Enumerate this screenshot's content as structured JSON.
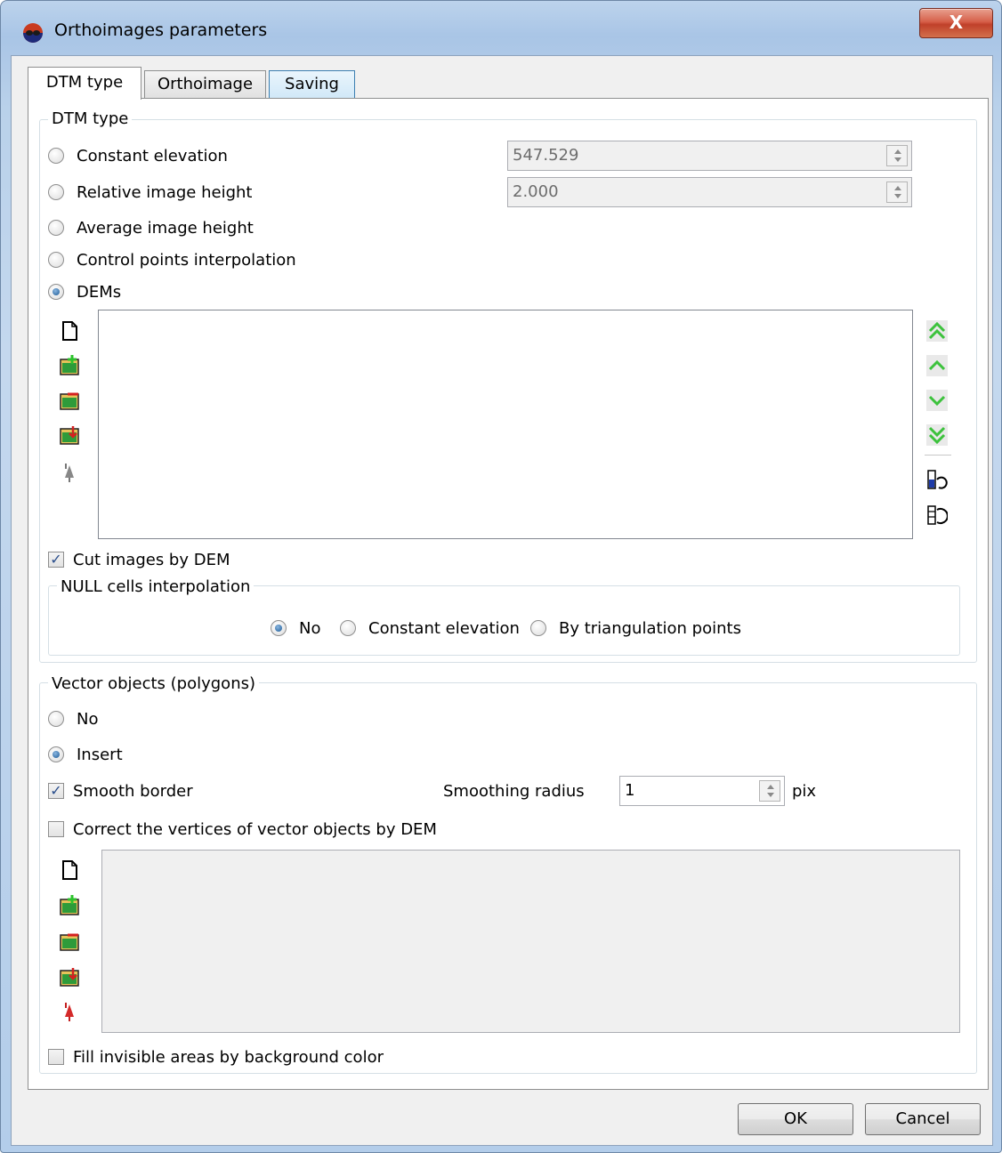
{
  "window": {
    "title": "Orthoimages parameters",
    "close_glyph": "X"
  },
  "tabs": [
    {
      "label": "DTM type",
      "active": true
    },
    {
      "label": "Orthoimage",
      "active": false
    },
    {
      "label": "Saving",
      "active": false
    }
  ],
  "dtm_group": {
    "title": "DTM type",
    "options": [
      {
        "label": "Constant elevation",
        "checked": false,
        "value": "547.529"
      },
      {
        "label": "Relative image height",
        "checked": false,
        "value": "2.000"
      },
      {
        "label": "Average image height",
        "checked": false
      },
      {
        "label": "Control points interpolation",
        "checked": false
      },
      {
        "label": "DEMs",
        "checked": true
      }
    ],
    "cut_images": {
      "label": "Cut images by DEM",
      "checked": true
    },
    "null_cells": {
      "title": "NULL cells interpolation",
      "options": [
        {
          "label": "No",
          "checked": true
        },
        {
          "label": "Constant elevation",
          "checked": false
        },
        {
          "label": "By triangulation points",
          "checked": false
        }
      ]
    }
  },
  "vector_group": {
    "title": "Vector objects (polygons)",
    "options": [
      {
        "label": "No",
        "checked": false
      },
      {
        "label": "Insert",
        "checked": true
      }
    ],
    "smooth_border": {
      "label": "Smooth border",
      "checked": true
    },
    "smoothing_radius": {
      "label": "Smoothing radius",
      "value": "1",
      "unit": "pix"
    },
    "correct_vertices": {
      "label": "Correct the vertices of vector objects by DEM",
      "checked": false
    },
    "fill_invisible": {
      "label": "Fill invisible areas by background color",
      "checked": false
    }
  },
  "footer": {
    "ok_label": "OK",
    "cancel_label": "Cancel"
  },
  "colors": {
    "accent_green": "#3cc23c",
    "close_red": "#c94a33",
    "panel_bg": "#f0f0f0"
  }
}
